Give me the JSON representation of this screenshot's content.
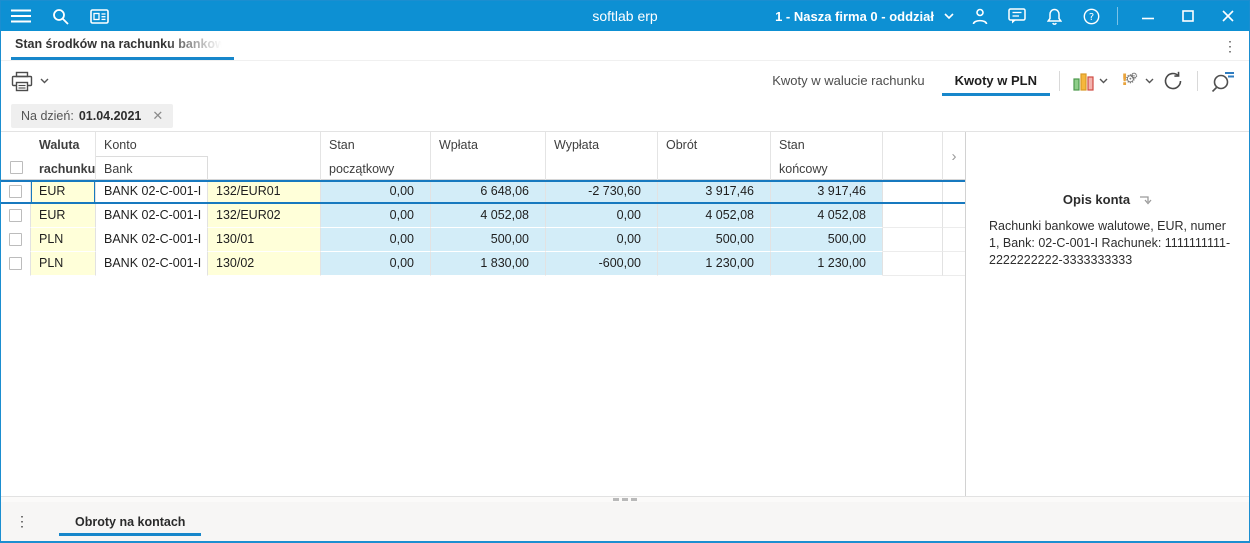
{
  "titlebar": {
    "app_title": "softlab erp",
    "company": "1 - Nasza firma 0 - oddział"
  },
  "tabs": {
    "main_tab": "Stan środków na rachunku bankowym na dzień"
  },
  "toolbar": {
    "view_currency_label": "Kwoty w walucie rachunku",
    "view_pln_label": "Kwoty w PLN"
  },
  "filter": {
    "label": "Na dzień:",
    "value": "01.04.2021",
    "close_glyph": "✕"
  },
  "table": {
    "headers": {
      "currency_l1": "Waluta",
      "currency_l2": "rachunku",
      "konto": "Konto",
      "bank": "Bank",
      "opening_l1": "Stan",
      "opening_l2": "początkowy",
      "deposit": "Wpłata",
      "withdrawal": "Wypłata",
      "turnover": "Obrót",
      "closing_l1": "Stan",
      "closing_l2": "końcowy"
    },
    "scroll_right_glyph": "›",
    "rows": [
      {
        "currency": "EUR",
        "bank": "BANK 02-C-001-I",
        "account": "132/EUR01",
        "opening": "0,00",
        "deposit": "6 648,06",
        "withdrawal": "-2 730,60",
        "turnover": "3 917,46",
        "closing": "3 917,46",
        "selected": true
      },
      {
        "currency": "EUR",
        "bank": "BANK 02-C-001-I",
        "account": "132/EUR02",
        "opening": "0,00",
        "deposit": "4 052,08",
        "withdrawal": "0,00",
        "turnover": "4 052,08",
        "closing": "4 052,08",
        "selected": false
      },
      {
        "currency": "PLN",
        "bank": "BANK 02-C-001-I",
        "account": "130/01",
        "opening": "0,00",
        "deposit": "500,00",
        "withdrawal": "0,00",
        "turnover": "500,00",
        "closing": "500,00",
        "selected": false
      },
      {
        "currency": "PLN",
        "bank": "BANK 02-C-001-I",
        "account": "130/02",
        "opening": "0,00",
        "deposit": "1 830,00",
        "withdrawal": "-600,00",
        "turnover": "1 230,00",
        "closing": "1 230,00",
        "selected": false
      }
    ]
  },
  "panel": {
    "title": "Opis konta",
    "description": "Rachunki bankowe walutowe, EUR, numer 1, Bank: 02-C-001-I Rachunek: 1111111111-2222222222-3333333333"
  },
  "bottom": {
    "tab": "Obroty na kontach"
  },
  "colors": {
    "titlebar": "#0d90d3",
    "accent_underline": "#1787cb",
    "selection": "#1779bf",
    "cell_yellow": "#ffffd9",
    "cell_blue": "#d3edf8",
    "chip_bg": "#efefef"
  }
}
